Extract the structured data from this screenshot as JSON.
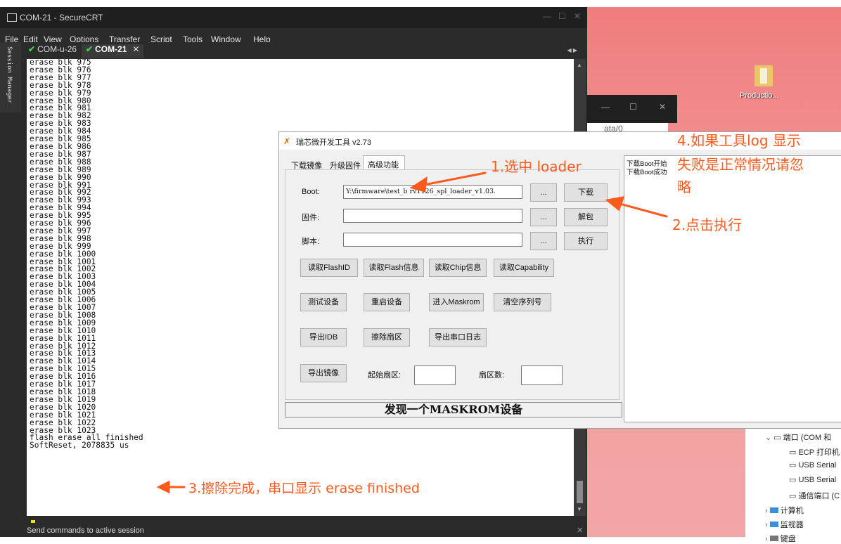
{
  "secure_crt": {
    "title": "COM-21 - SecureCRT",
    "menu": [
      "File",
      "Edit",
      "View",
      "Options",
      "Transfer",
      "Script",
      "Tools",
      "Window",
      "Help"
    ],
    "session_manager": "Session Manager",
    "tabs": [
      "COM-u-26",
      "COM-21"
    ],
    "terminal_lines": [
      "erase blk 975",
      "erase blk 976",
      "erase blk 977",
      "erase blk 978",
      "erase blk 979",
      "erase blk 980",
      "erase blk 981",
      "erase blk 982",
      "erase blk 983",
      "erase blk 984",
      "erase blk 985",
      "erase blk 986",
      "erase blk 987",
      "erase blk 988",
      "erase blk 989",
      "erase blk 990",
      "erase blk 991",
      "erase blk 992",
      "erase blk 993",
      "erase blk 994",
      "erase blk 995",
      "erase blk 996",
      "erase blk 997",
      "erase blk 998",
      "erase blk 999",
      "erase blk 1000",
      "erase blk 1001",
      "erase blk 1002",
      "erase blk 1003",
      "erase blk 1004",
      "erase blk 1005",
      "erase blk 1006",
      "erase blk 1007",
      "erase blk 1008",
      "erase blk 1009",
      "erase blk 1010",
      "erase blk 1011",
      "erase blk 1012",
      "erase blk 1013",
      "erase blk 1014",
      "erase blk 1015",
      "erase blk 1016",
      "erase blk 1017",
      "erase blk 1018",
      "erase blk 1019",
      "erase blk 1020",
      "erase blk 1021",
      "erase blk 1022",
      "erase blk 1023",
      "flash erase all finished",
      "SoftReset, 2078835 us"
    ],
    "command_bar": "Send commands to active session"
  },
  "tool": {
    "title": "瑞芯微开发工具 v2.73",
    "tabs": [
      "下载镜像",
      "升级固件",
      "高级功能"
    ],
    "boot_label": "Boot:",
    "boot_path": "Y:\\firmware\\test_b  rv1126_spl_loader_v1.03.",
    "firmware_label": "固件:",
    "script_label": "脚本:",
    "browse": "...",
    "btn_download": "下载",
    "btn_unpack": "解包",
    "btn_execute": "执行",
    "btn_read_flash_id": "读取FlashID",
    "btn_read_flash_info": "读取Flash信息",
    "btn_read_chip_info": "读取Chip信息",
    "btn_read_capability": "读取Capability",
    "btn_test_device": "测试设备",
    "btn_reset_device": "重启设备",
    "btn_enter_maskrom": "进入Maskrom",
    "btn_clear_serial": "清空序列号",
    "btn_export_idb": "导出IDB",
    "btn_erase_sector": "擦除扇区",
    "btn_export_serial_log": "导出串口日志",
    "btn_export_image": "导出镜像",
    "start_sector_label": "起始扇区:",
    "sector_count_label": "扇区数:",
    "status": "发现一个MASKROM设备",
    "log": [
      "下载Boot开始",
      "下载Boot成功"
    ]
  },
  "background": {
    "dark_window_text": "ata/0",
    "desktop_icon_label": "Productio..."
  },
  "device_manager": {
    "items": [
      "端口 (COM 和",
      "ECP 打印机",
      "USB Serial",
      "USB Serial",
      "通信端口 (C",
      "计算机",
      "监视器",
      "键盘"
    ]
  },
  "annotations": {
    "step1": "1.选中 loader",
    "step2": "2.点击执行",
    "step3": "3.擦除完成，串口显示 erase finished",
    "step4_line1": "4.如果工具log 显示",
    "step4_line2": "失败是正常情况请忽",
    "step4_line3": "略"
  },
  "colors": {
    "annotation": "#ff5a1e",
    "terminal_bg": "#ffffff",
    "crt_chrome": "#2b2b2b",
    "desktop": "#f07d7d"
  }
}
